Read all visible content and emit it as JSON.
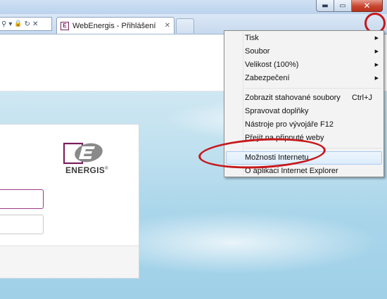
{
  "window": {
    "minimize_glyph": "▬",
    "maximize_glyph": "▭",
    "close_glyph": "✕"
  },
  "addressbar": {
    "search_glyph": "⚲",
    "dropdown_glyph": "▾",
    "lock_glyph": "🔒",
    "refresh_glyph": "↻",
    "stop_glyph": "✕"
  },
  "tab": {
    "title": "WebEnergis - Přihlášení",
    "close_glyph": "✕"
  },
  "toolbar_icons": [
    "home-icon",
    "favorites-icon",
    "gear-icon"
  ],
  "logo": {
    "text": "ENERGIS",
    "mark": "®",
    "letter": "E"
  },
  "menu": {
    "items": [
      {
        "label": "Tisk",
        "submenu": true
      },
      {
        "label": "Soubor",
        "submenu": true
      },
      {
        "label": "Velikost (100%)",
        "submenu": true
      },
      {
        "label": "Zabezpečení",
        "submenu": true
      },
      {
        "label": "Zobrazit stahované soubory",
        "shortcut": "Ctrl+J"
      },
      {
        "label": "Spravovat doplňky"
      },
      {
        "label": "Nástroje pro vývojáře F12"
      },
      {
        "label": "Přejít na připnuté weby"
      },
      {
        "label": "Možnosti Internetu"
      },
      {
        "label": "O aplikaci Internet Explorer"
      }
    ]
  },
  "colors": {
    "highlight_red": "#c6181b",
    "brand_purple": "#7a1f5c",
    "menu_bg": "#f3f3f3"
  }
}
